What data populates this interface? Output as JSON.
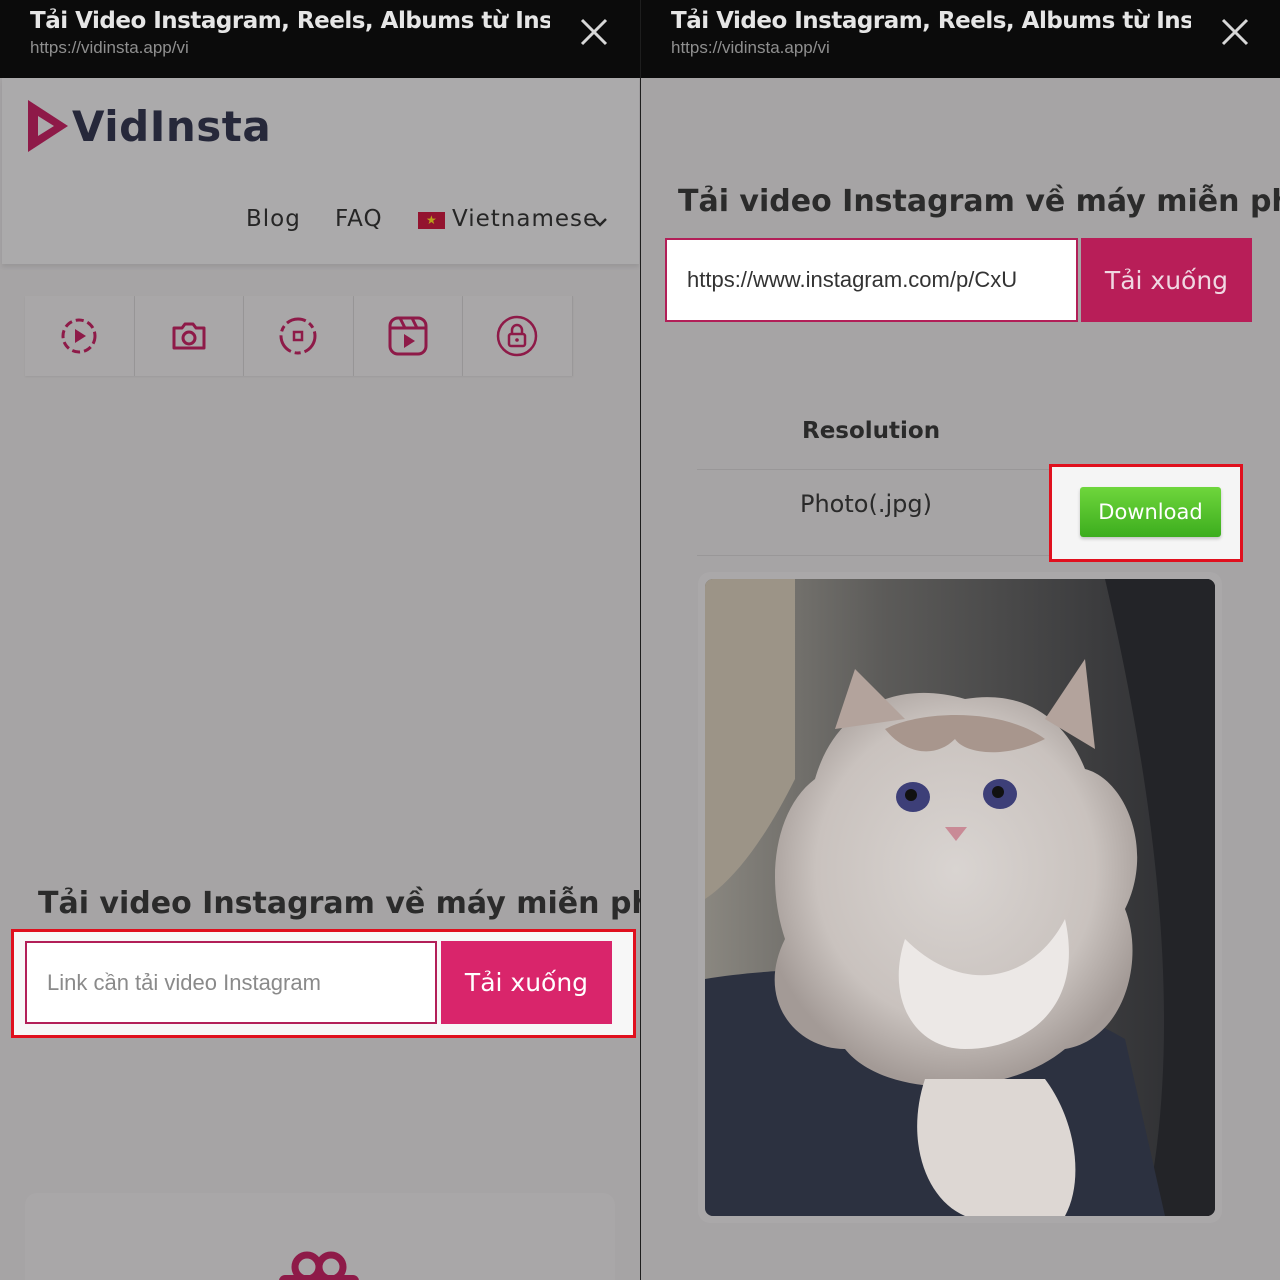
{
  "left": {
    "topbar": {
      "title": "Tải Video Instagram, Reels, Albums từ Inst...",
      "url": "https://vidinsta.app/vi",
      "close_icon": "close-icon"
    },
    "brand": {
      "name": "VidInsta",
      "logo_icon": "play-triangle-logo"
    },
    "nav": {
      "blog": "Blog",
      "faq": "FAQ",
      "language": "Vietnamese",
      "flag_icon": "vietnam-flag-icon",
      "chevron_icon": "chevron-down-icon"
    },
    "tools": [
      {
        "icon": "video-play-icon"
      },
      {
        "icon": "camera-icon"
      },
      {
        "icon": "story-icon"
      },
      {
        "icon": "reels-icon"
      },
      {
        "icon": "private-lock-icon"
      }
    ],
    "heading": "Tải video Instagram về máy miễn phí",
    "form": {
      "placeholder": "Link cần tải video Instagram",
      "button": "Tải xuống"
    }
  },
  "right": {
    "topbar": {
      "title": "Tải Video Instagram, Reels, Albums từ Inst...",
      "url": "https://vidinsta.app/vi",
      "close_icon": "close-icon"
    },
    "heading": "Tải video Instagram về máy miễn phí",
    "form": {
      "value": "https://www.instagram.com/p/CxU",
      "button": "Tải xuống"
    },
    "results": {
      "header": "Resolution",
      "rows": [
        {
          "resolution": "Photo(.jpg)",
          "action": "Download"
        }
      ]
    },
    "preview_image": "cat-photo"
  },
  "colors": {
    "accent": "#d9256b",
    "brand_dark": "#8e1a48",
    "download_green": "#4cbd28",
    "highlight_red": "#e0101e"
  }
}
